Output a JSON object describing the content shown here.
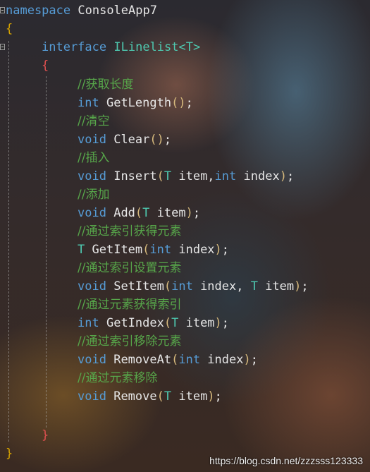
{
  "code": {
    "namespace_kw": "namespace",
    "namespace_name": "ConsoleApp7",
    "open_brace_outer": "{",
    "interface_kw": "interface",
    "interface_name": "ILinelist<T>",
    "open_brace_inner": "{",
    "members": [
      {
        "comment": "//获取长度",
        "ret": "int",
        "name": "GetLength",
        "params": ""
      },
      {
        "comment": "//清空",
        "ret": "void",
        "name": "Clear",
        "params": ""
      },
      {
        "comment": "//插入",
        "ret": "void",
        "name": "Insert",
        "params": "T item,int index"
      },
      {
        "comment": "//添加",
        "ret": "void",
        "name": "Add",
        "params": "T item"
      },
      {
        "comment": "//通过索引获得元素",
        "ret": "T",
        "name": "GetItem",
        "params": "int index"
      },
      {
        "comment": "//通过索引设置元素",
        "ret": "void",
        "name": "SetItem",
        "params": "int index, T item"
      },
      {
        "comment": "//通过元素获得索引",
        "ret": "int",
        "name": "GetIndex",
        "params": "T item"
      },
      {
        "comment": "//通过索引移除元素",
        "ret": "void",
        "name": "RemoveAt",
        "params": "int index"
      },
      {
        "comment": "//通过元素移除",
        "ret": "void",
        "name": "Remove",
        "params": "T item"
      }
    ],
    "close_brace_inner": "}",
    "close_brace_outer": "}"
  },
  "watermark": "https://blog.csdn.net/zzzsss123333",
  "colors": {
    "keyword": "#569cd6",
    "type": "#4ec9b0",
    "comment": "#57a64a",
    "brace_outer": "#d7a400",
    "brace_inner": "#e05050"
  }
}
